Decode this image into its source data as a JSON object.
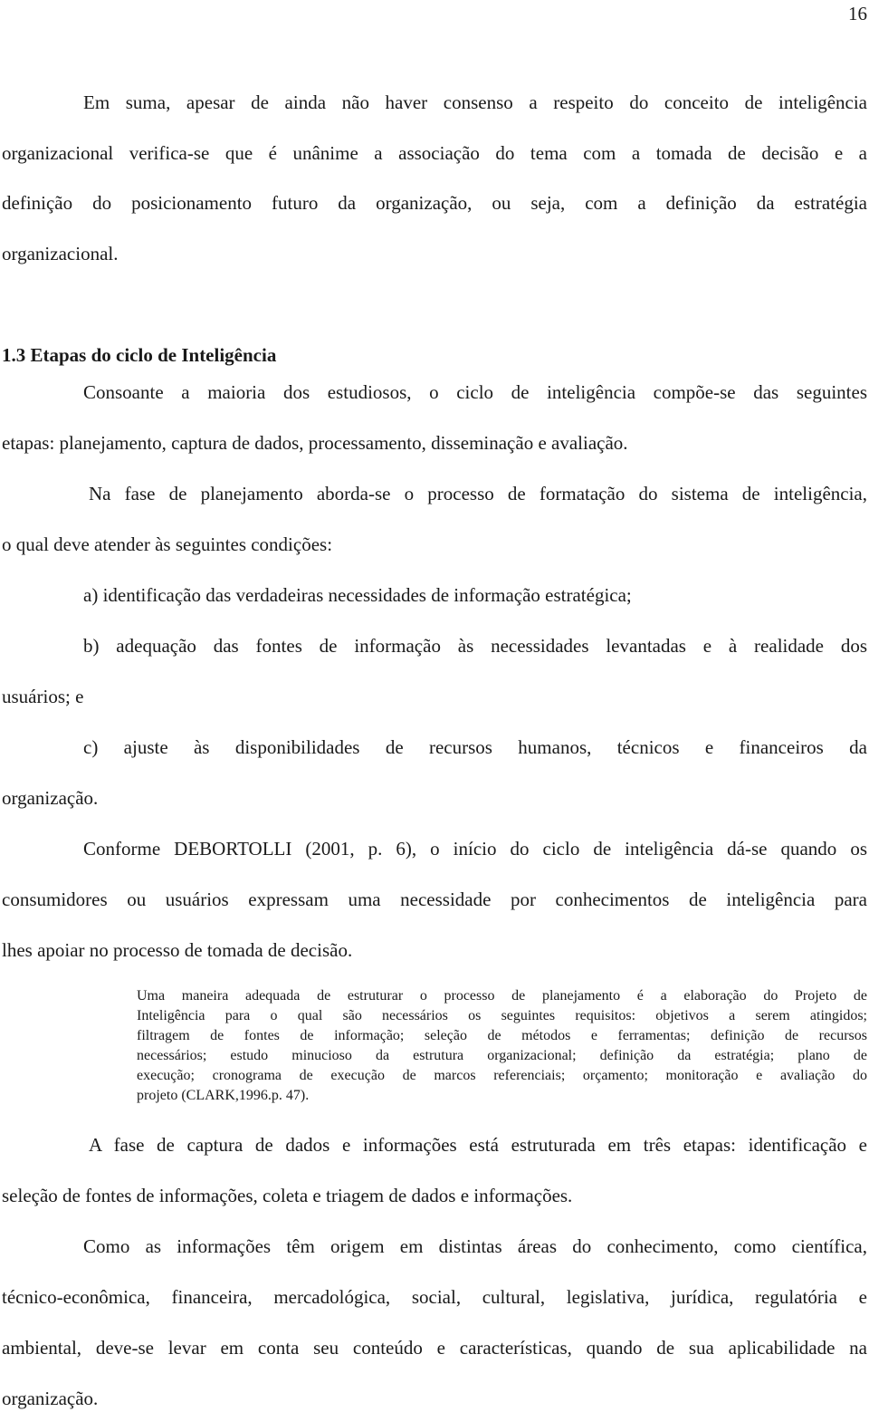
{
  "page_number": "16",
  "paragraphs": {
    "p1": [
      "Em suma, apesar de ainda não haver consenso a respeito do conceito de inteligência",
      "organizacional verifica-se que é unânime a associação do tema com a tomada de decisão e a",
      "definição do posicionamento futuro da organização, ou seja, com a definição da estratégia",
      "organizacional."
    ],
    "section_heading": "1.3  Etapas do ciclo de Inteligência",
    "p2": [
      "Consoante a maioria dos estudiosos, o ciclo de inteligência compõe-se das seguintes",
      "etapas: planejamento, captura de dados, processamento, disseminação e avaliação."
    ],
    "p3": [
      "Na fase de planejamento aborda-se o processo de formatação do sistema de inteligência,",
      "o qual deve atender às seguintes condições:"
    ],
    "list": {
      "a": [
        "a)  identificação das verdadeiras necessidades de informação estratégica;"
      ],
      "b": [
        "b) adequação das fontes de informação às necessidades levantadas e à realidade dos",
        "usuários; e"
      ],
      "c": [
        "c) ajuste às disponibilidades de recursos humanos, técnicos e financeiros da",
        "organização."
      ]
    },
    "p4": [
      "Conforme DEBORTOLLI (2001, p. 6), o início do ciclo de inteligência dá-se quando os",
      "consumidores ou usuários expressam uma necessidade por conhecimentos de inteligência para",
      "lhes apoiar no processo de tomada de decisão."
    ],
    "quote": [
      "Uma maneira adequada de estruturar o processo de planejamento é a elaboração do Projeto de",
      "Inteligência para o qual são necessários os seguintes requisitos: objetivos a serem atingidos;",
      "filtragem de fontes de informação; seleção de métodos e ferramentas; definição de recursos",
      "necessários; estudo minucioso da estrutura organizacional; definição da estratégia; plano de",
      "execução; cronograma de execução de marcos referenciais; orçamento; monitoração e avaliação do",
      "projeto  (CLARK,1996.p. 47)."
    ],
    "p5": [
      "A fase de captura de dados e informações está estruturada em três etapas: identificação e",
      "seleção de fontes de informações, coleta e triagem de dados e informações."
    ],
    "p6": [
      "Como as informações têm origem em distintas áreas do conhecimento, como científica,",
      "técnico-econômica, financeira, mercadológica, social, cultural, legislativa, jurídica, regulatória e",
      "ambiental, deve-se levar em conta seu conteúdo e características, quando de sua aplicabilidade na",
      "organização."
    ]
  }
}
